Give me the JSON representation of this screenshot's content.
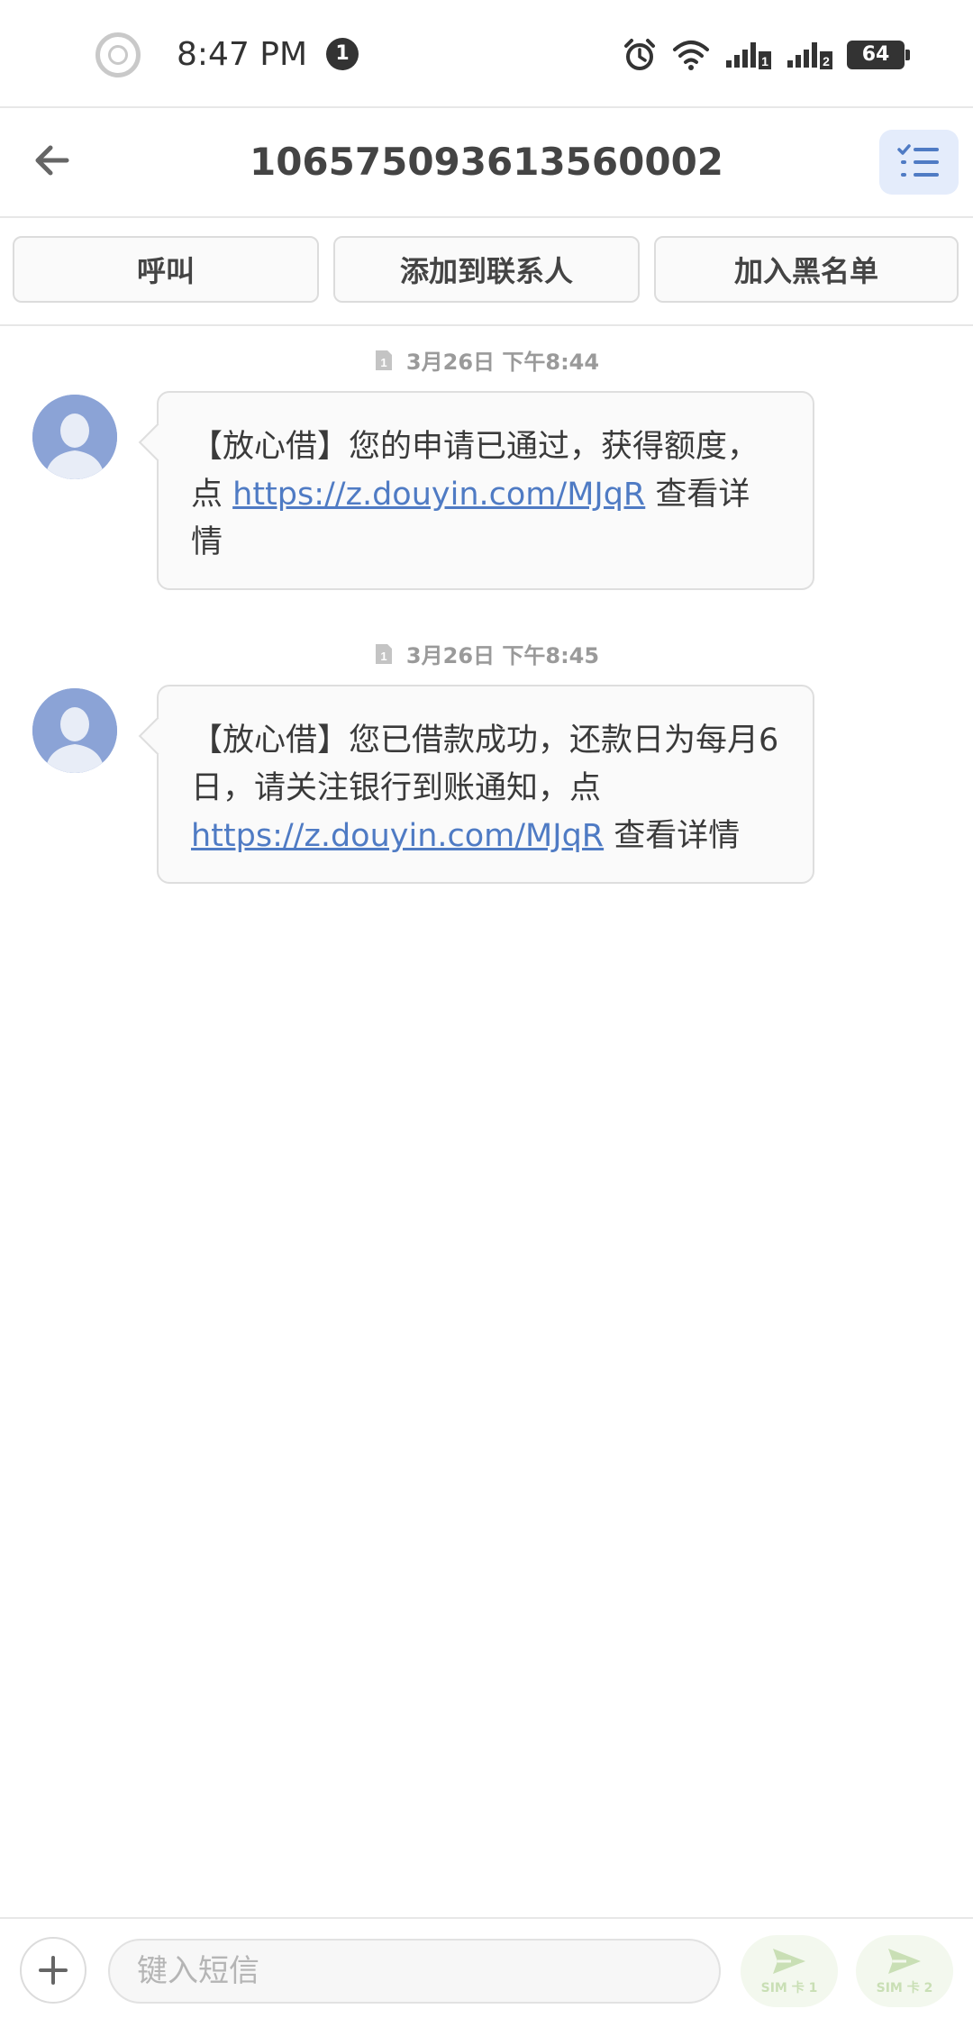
{
  "status_bar": {
    "time": "8:47 PM",
    "notification_count": "1",
    "battery": "64",
    "sim1_label": "1",
    "sim2_label": "2"
  },
  "header": {
    "title": "106575093613560002"
  },
  "actions": {
    "call": "呼叫",
    "add_contact": "添加到联系人",
    "blacklist": "加入黑名单"
  },
  "messages": [
    {
      "timestamp": "3月26日 下午8:44",
      "text_before": "【放心借】您的申请已通过，获得额度，点 ",
      "link": "https://z.douyin.com/MJqR",
      "text_after": " 查看详情"
    },
    {
      "timestamp": "3月26日 下午8:45",
      "text_before": "【放心借】您已借款成功，还款日为每月6日，请关注银行到账通知，点 ",
      "link": "https://z.douyin.com/MJqR",
      "text_after": " 查看详情"
    }
  ],
  "composer": {
    "placeholder": "键入短信",
    "send_sim1": "SIM 卡 1",
    "send_sim2": "SIM 卡 2"
  },
  "colors": {
    "accent": "#4f7bc4",
    "avatar": "#8ba3d6",
    "send_disabled": "#c9dfb5"
  }
}
